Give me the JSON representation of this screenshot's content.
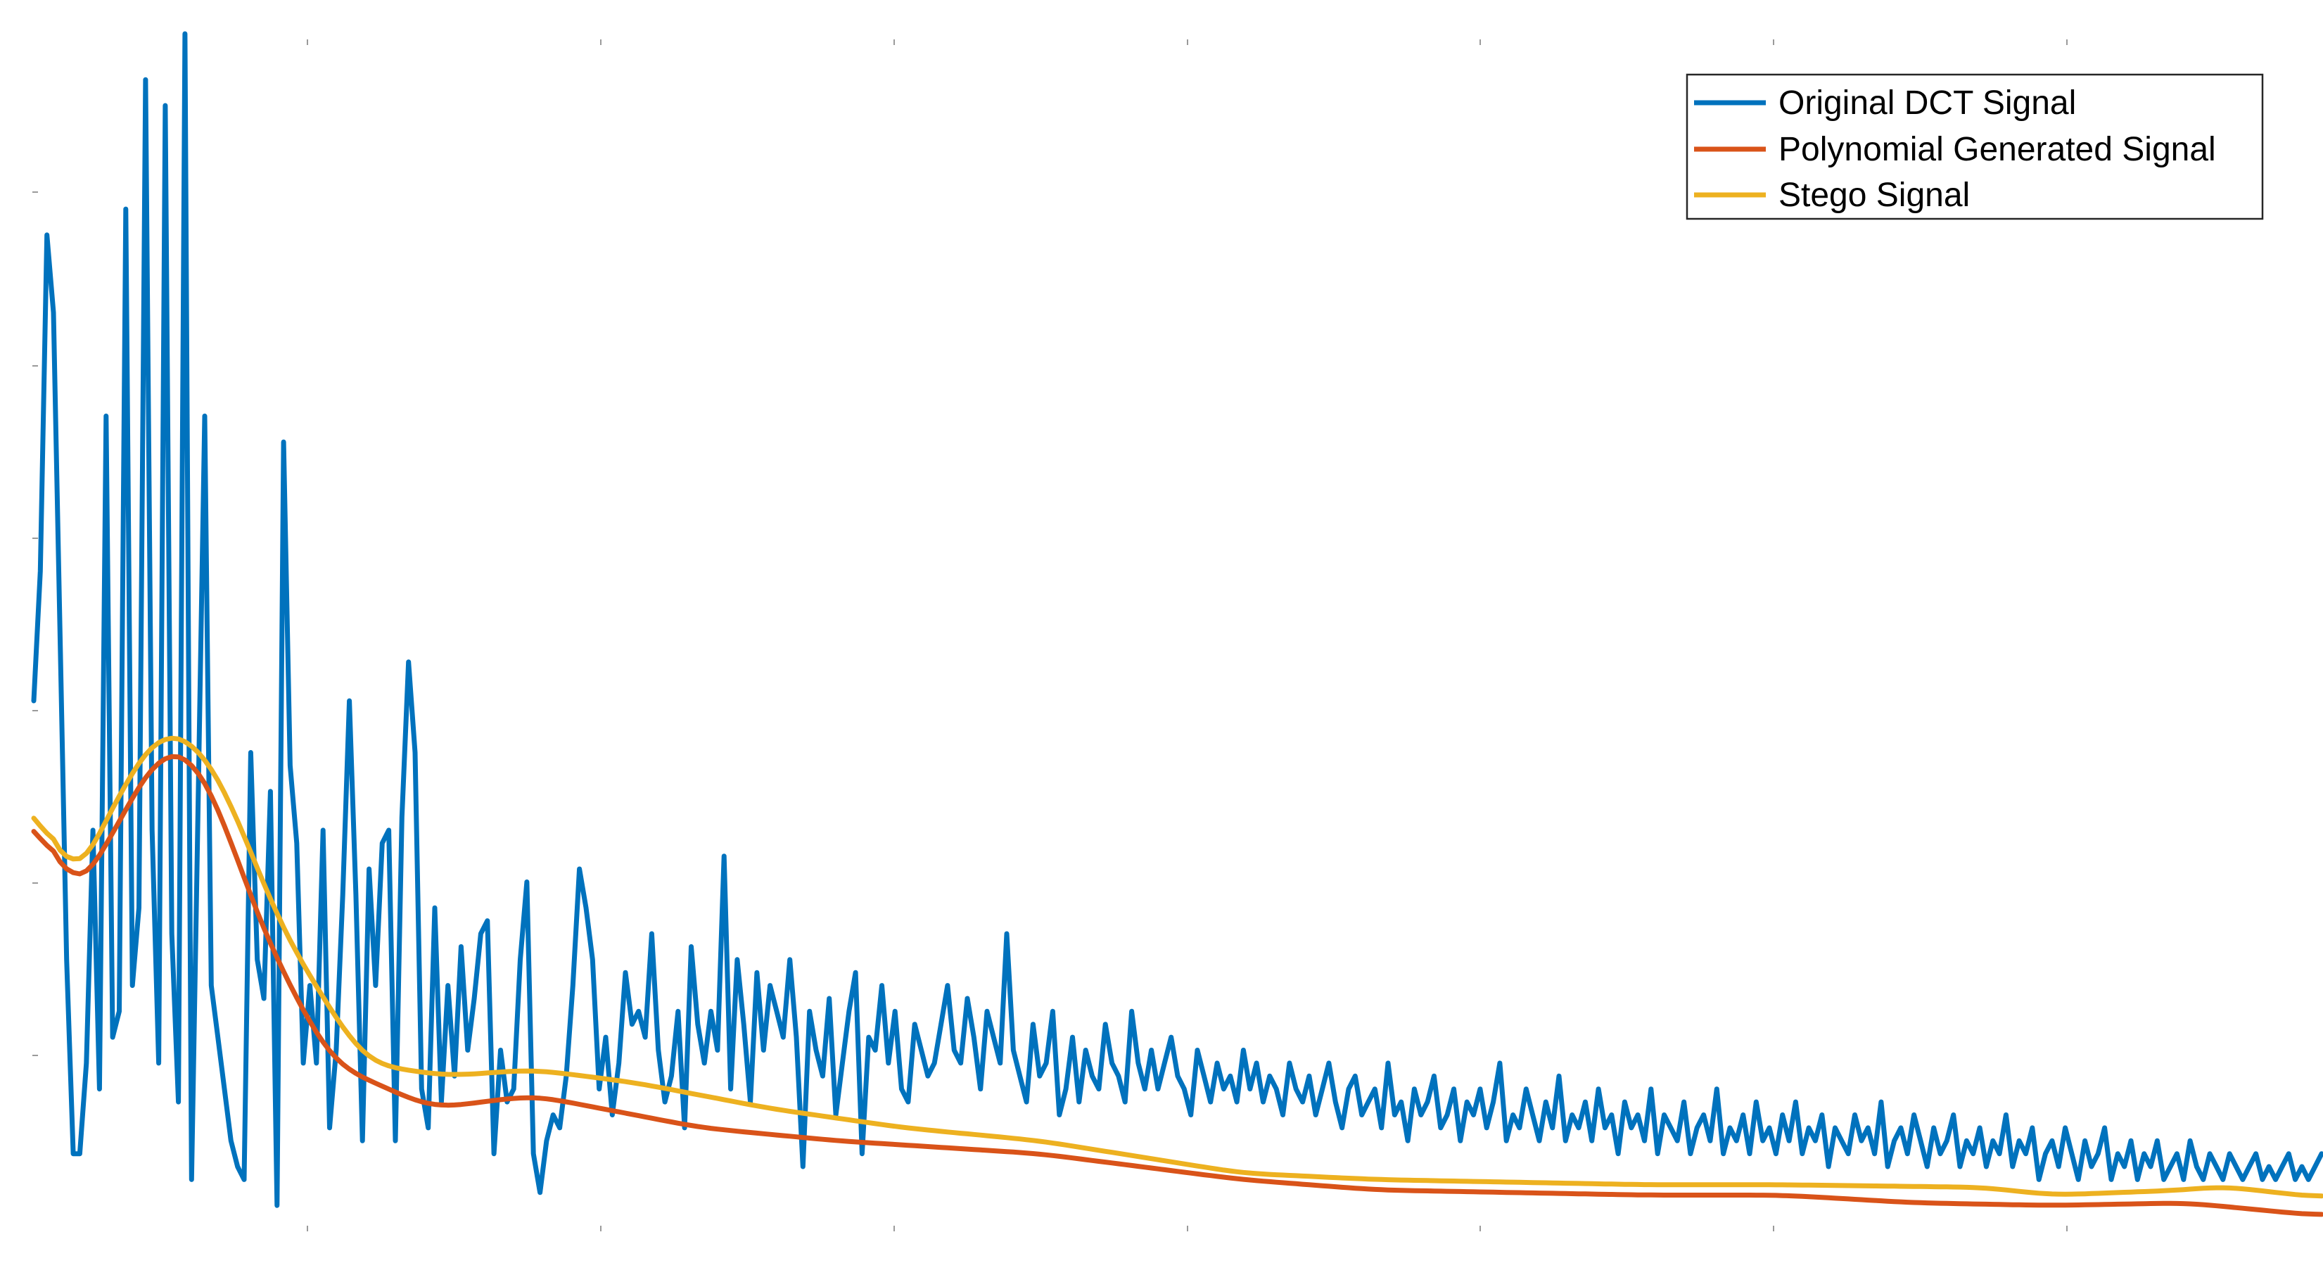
{
  "chart_data": {
    "type": "line",
    "title": "",
    "xlabel": "",
    "ylabel": "",
    "grid": false,
    "legend_position": "top-right",
    "xlim": [
      1,
      340
    ],
    "ylim": [
      -0.01,
      0.91
    ],
    "series": [
      {
        "name": "Original DCT Signal",
        "color": "#0072BD",
        "values": [
          0.4,
          0.5,
          0.76,
          0.7,
          0.45,
          0.2,
          0.05,
          0.05,
          0.12,
          0.3,
          0.1,
          0.62,
          0.14,
          0.16,
          0.78,
          0.18,
          0.24,
          0.88,
          0.3,
          0.12,
          0.86,
          0.22,
          0.09,
          1.05,
          0.03,
          0.32,
          0.62,
          0.18,
          0.14,
          0.1,
          0.06,
          0.04,
          0.03,
          0.36,
          0.2,
          0.17,
          0.33,
          0.01,
          0.6,
          0.35,
          0.29,
          0.12,
          0.18,
          0.12,
          0.3,
          0.07,
          0.13,
          0.25,
          0.4,
          0.25,
          0.06,
          0.27,
          0.18,
          0.29,
          0.3,
          0.06,
          0.31,
          0.43,
          0.36,
          0.1,
          0.07,
          0.24,
          0.09,
          0.18,
          0.11,
          0.21,
          0.13,
          0.17,
          0.22,
          0.23,
          0.05,
          0.13,
          0.09,
          0.1,
          0.2,
          0.26,
          0.05,
          0.02,
          0.06,
          0.08,
          0.07,
          0.11,
          0.18,
          0.27,
          0.24,
          0.2,
          0.1,
          0.14,
          0.08,
          0.12,
          0.19,
          0.15,
          0.16,
          0.14,
          0.22,
          0.13,
          0.09,
          0.11,
          0.16,
          0.07,
          0.21,
          0.15,
          0.12,
          0.16,
          0.13,
          0.28,
          0.1,
          0.2,
          0.15,
          0.09,
          0.19,
          0.13,
          0.18,
          0.16,
          0.14,
          0.2,
          0.14,
          0.04,
          0.16,
          0.13,
          0.11,
          0.17,
          0.08,
          0.12,
          0.16,
          0.19,
          0.05,
          0.14,
          0.13,
          0.18,
          0.12,
          0.16,
          0.1,
          0.09,
          0.15,
          0.13,
          0.11,
          0.12,
          0.15,
          0.18,
          0.13,
          0.12,
          0.17,
          0.14,
          0.1,
          0.16,
          0.14,
          0.12,
          0.22,
          0.13,
          0.11,
          0.09,
          0.15,
          0.11,
          0.12,
          0.16,
          0.08,
          0.1,
          0.14,
          0.09,
          0.13,
          0.11,
          0.1,
          0.15,
          0.12,
          0.11,
          0.09,
          0.16,
          0.12,
          0.1,
          0.13,
          0.1,
          0.12,
          0.14,
          0.11,
          0.1,
          0.08,
          0.13,
          0.11,
          0.09,
          0.12,
          0.1,
          0.11,
          0.09,
          0.13,
          0.1,
          0.12,
          0.09,
          0.11,
          0.1,
          0.08,
          0.12,
          0.1,
          0.09,
          0.11,
          0.08,
          0.1,
          0.12,
          0.09,
          0.07,
          0.1,
          0.11,
          0.08,
          0.09,
          0.1,
          0.07,
          0.12,
          0.08,
          0.09,
          0.06,
          0.1,
          0.08,
          0.09,
          0.11,
          0.07,
          0.08,
          0.1,
          0.06,
          0.09,
          0.08,
          0.1,
          0.07,
          0.09,
          0.12,
          0.06,
          0.08,
          0.07,
          0.1,
          0.08,
          0.06,
          0.09,
          0.07,
          0.11,
          0.06,
          0.08,
          0.07,
          0.09,
          0.06,
          0.1,
          0.07,
          0.08,
          0.05,
          0.09,
          0.07,
          0.08,
          0.06,
          0.1,
          0.05,
          0.08,
          0.07,
          0.06,
          0.09,
          0.05,
          0.07,
          0.08,
          0.06,
          0.1,
          0.05,
          0.07,
          0.06,
          0.08,
          0.05,
          0.09,
          0.06,
          0.07,
          0.05,
          0.08,
          0.06,
          0.09,
          0.05,
          0.07,
          0.06,
          0.08,
          0.04,
          0.07,
          0.06,
          0.05,
          0.08,
          0.06,
          0.07,
          0.05,
          0.09,
          0.04,
          0.06,
          0.07,
          0.05,
          0.08,
          0.06,
          0.04,
          0.07,
          0.05,
          0.06,
          0.08,
          0.04,
          0.06,
          0.05,
          0.07,
          0.04,
          0.06,
          0.05,
          0.08,
          0.04,
          0.06,
          0.05,
          0.07,
          0.03,
          0.05,
          0.06,
          0.04,
          0.07,
          0.05,
          0.03,
          0.06,
          0.04,
          0.05,
          0.07,
          0.03,
          0.05,
          0.04,
          0.06,
          0.03,
          0.05,
          0.04,
          0.06,
          0.03,
          0.04,
          0.05,
          0.03,
          0.06,
          0.04,
          0.03,
          0.05,
          0.04,
          0.03,
          0.05,
          0.04,
          0.03,
          0.04,
          0.05,
          0.03,
          0.04,
          0.03,
          0.04,
          0.05,
          0.03,
          0.04,
          0.03,
          0.04,
          0.05
        ]
      },
      {
        "name": "Polynomial Generated Signal",
        "color": "#D95319",
        "values": []
      },
      {
        "name": "Stego Signal",
        "color": "#EDB120",
        "values": []
      }
    ],
    "poly_knots": [
      [
        1,
        0.36
      ],
      [
        5,
        0.24
      ],
      [
        10,
        0.27
      ],
      [
        18,
        0.35
      ],
      [
        22,
        0.37
      ],
      [
        27,
        0.34
      ],
      [
        35,
        0.22
      ],
      [
        45,
        0.12
      ],
      [
        60,
        0.085
      ],
      [
        75,
        0.095
      ],
      [
        85,
        0.085
      ],
      [
        100,
        0.07
      ],
      [
        120,
        0.06
      ],
      [
        150,
        0.05
      ],
      [
        180,
        0.03
      ],
      [
        200,
        0.022
      ],
      [
        240,
        0.018
      ],
      [
        260,
        0.018
      ],
      [
        280,
        0.012
      ],
      [
        300,
        0.01
      ],
      [
        320,
        0.012
      ],
      [
        340,
        0.002
      ]
    ],
    "stego_knots": [
      [
        1,
        0.38
      ],
      [
        5,
        0.24
      ],
      [
        10,
        0.29
      ],
      [
        18,
        0.37
      ],
      [
        22,
        0.38
      ],
      [
        28,
        0.35
      ],
      [
        38,
        0.22
      ],
      [
        50,
        0.12
      ],
      [
        62,
        0.11
      ],
      [
        75,
        0.115
      ],
      [
        90,
        0.105
      ],
      [
        110,
        0.085
      ],
      [
        130,
        0.07
      ],
      [
        150,
        0.06
      ],
      [
        180,
        0.035
      ],
      [
        200,
        0.03
      ],
      [
        240,
        0.026
      ],
      [
        260,
        0.026
      ],
      [
        290,
        0.024
      ],
      [
        300,
        0.018
      ],
      [
        320,
        0.022
      ],
      [
        325,
        0.025
      ],
      [
        340,
        0.016
      ]
    ]
  }
}
